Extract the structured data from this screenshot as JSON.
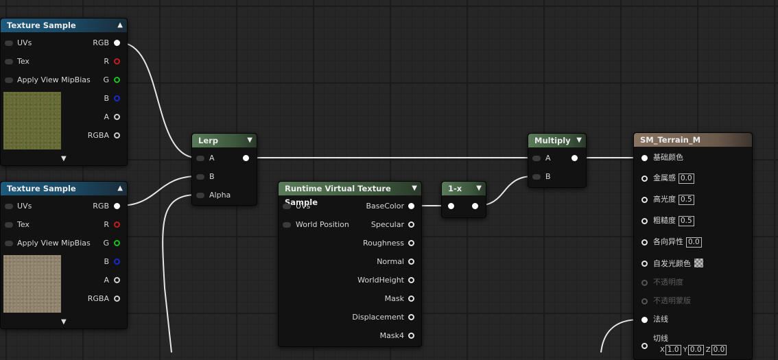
{
  "texture_sample_1": {
    "title": "Texture Sample",
    "inputs": [
      "UVs",
      "Tex",
      "Apply View MipBias"
    ],
    "outputs": [
      "RGB",
      "R",
      "G",
      "B",
      "A",
      "RGBA"
    ]
  },
  "texture_sample_2": {
    "title": "Texture Sample",
    "inputs": [
      "UVs",
      "Tex",
      "Apply View MipBias"
    ],
    "outputs": [
      "RGB",
      "R",
      "G",
      "B",
      "A",
      "RGBA"
    ]
  },
  "lerp": {
    "title": "Lerp",
    "inputs": [
      "A",
      "B",
      "Alpha"
    ]
  },
  "rvt": {
    "title": "Runtime Virtual Texture Sample",
    "inputs": [
      "UVs",
      "World Position"
    ],
    "outputs": [
      "BaseColor",
      "Specular",
      "Roughness",
      "Normal",
      "WorldHeight",
      "Mask",
      "Displacement",
      "Mask4"
    ]
  },
  "one_minus": {
    "title": "1-x"
  },
  "multiply": {
    "title": "Multiply",
    "inputs": [
      "A",
      "B"
    ]
  },
  "material": {
    "title": "SM_Terrain_M",
    "inputs": [
      "基础颜色",
      "金属感",
      "高光度",
      "粗糙度",
      "各向异性",
      "自发光颜色",
      "不透明度",
      "不透明蒙版",
      "法线",
      "切线"
    ],
    "values": {
      "metallic": "0.0",
      "specular": "0.5",
      "roughness": "0.5",
      "anisotropy": "0.0"
    },
    "tangent": {
      "x_label": "X",
      "x": "1.0",
      "y_label": "Y",
      "y": "0.0",
      "z_label": "Z",
      "z": "0.0"
    }
  },
  "icons": {
    "collapse": "chevron-up-icon",
    "dropdown": "chevron-down-icon",
    "expand": "chevron-down-icon"
  },
  "colors": {
    "texture_header": "#1d5a7c",
    "math_header": "#5a7c5a",
    "material_header": "#8a7462",
    "pin_r": "#c81c1c",
    "pin_g": "#18c418",
    "pin_b": "#1a2ad0"
  }
}
